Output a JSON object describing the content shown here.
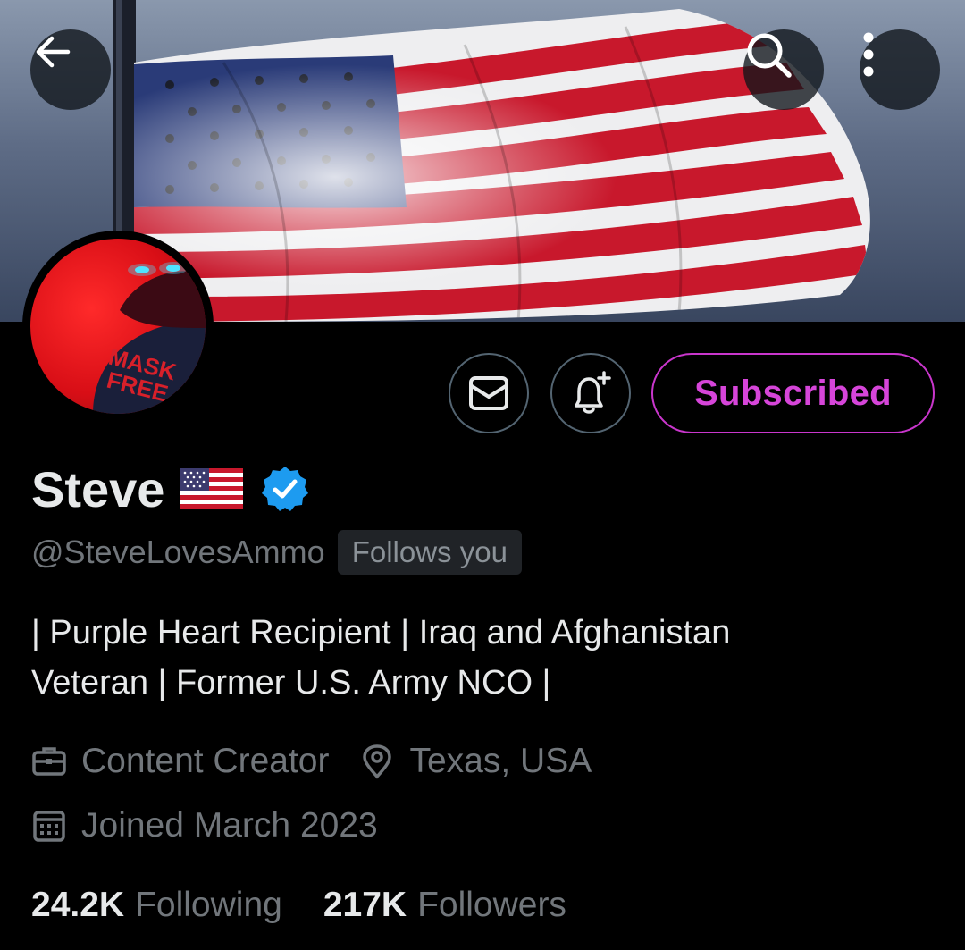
{
  "header": {
    "back_icon": "arrow-left-icon",
    "search_icon": "search-icon",
    "more_icon": "more-vertical-icon"
  },
  "profile": {
    "name": "Steve",
    "name_flag_emoji": "🇺🇸",
    "verified": true,
    "handle": "@SteveLovesAmmo",
    "follows_you_badge": "Follows you",
    "bio_line1": "| Purple Heart Recipient | Iraq and Afghanistan",
    "bio_line2": "Veteran | Former U.S. Army NCO |",
    "category": "Content Creator",
    "location": "Texas, USA",
    "joined": "Joined March 2023",
    "avatar_text_line1": "MASK",
    "avatar_text_line2": "FREE"
  },
  "actions": {
    "message_icon": "mail-icon",
    "notify_icon": "bell-plus-icon",
    "subscribed_label": "Subscribed"
  },
  "stats": {
    "following_count": "24.2K",
    "following_label": "Following",
    "followers_count": "217K",
    "followers_label": "Followers"
  },
  "colors": {
    "background": "#000000",
    "primary_text": "#e7e9ea",
    "secondary_text": "#71767b",
    "subscribed_accent": "#d645d9",
    "verified_blue": "#1d9bf0"
  }
}
